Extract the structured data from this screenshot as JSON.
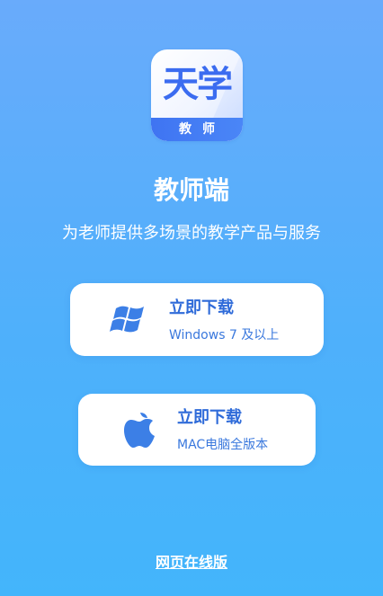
{
  "logo": {
    "main_text": "天学",
    "band_text": "教师"
  },
  "title": "教师端",
  "subtitle": "为老师提供多场景的教学产品与服务",
  "downloads": [
    {
      "icon": "windows-icon",
      "label": "立即下载",
      "sub": "Windows 7 及以上"
    },
    {
      "icon": "apple-icon",
      "label": "立即下载",
      "sub": "MAC电脑全版本"
    }
  ],
  "web_version_link": "网页在线版",
  "colors": {
    "background_top": "#69abfb",
    "background_bottom": "#43b5fb",
    "accent_blue": "#2f6bd9",
    "icon_blue": "#3c7fe6",
    "card_bg": "#ffffff"
  }
}
